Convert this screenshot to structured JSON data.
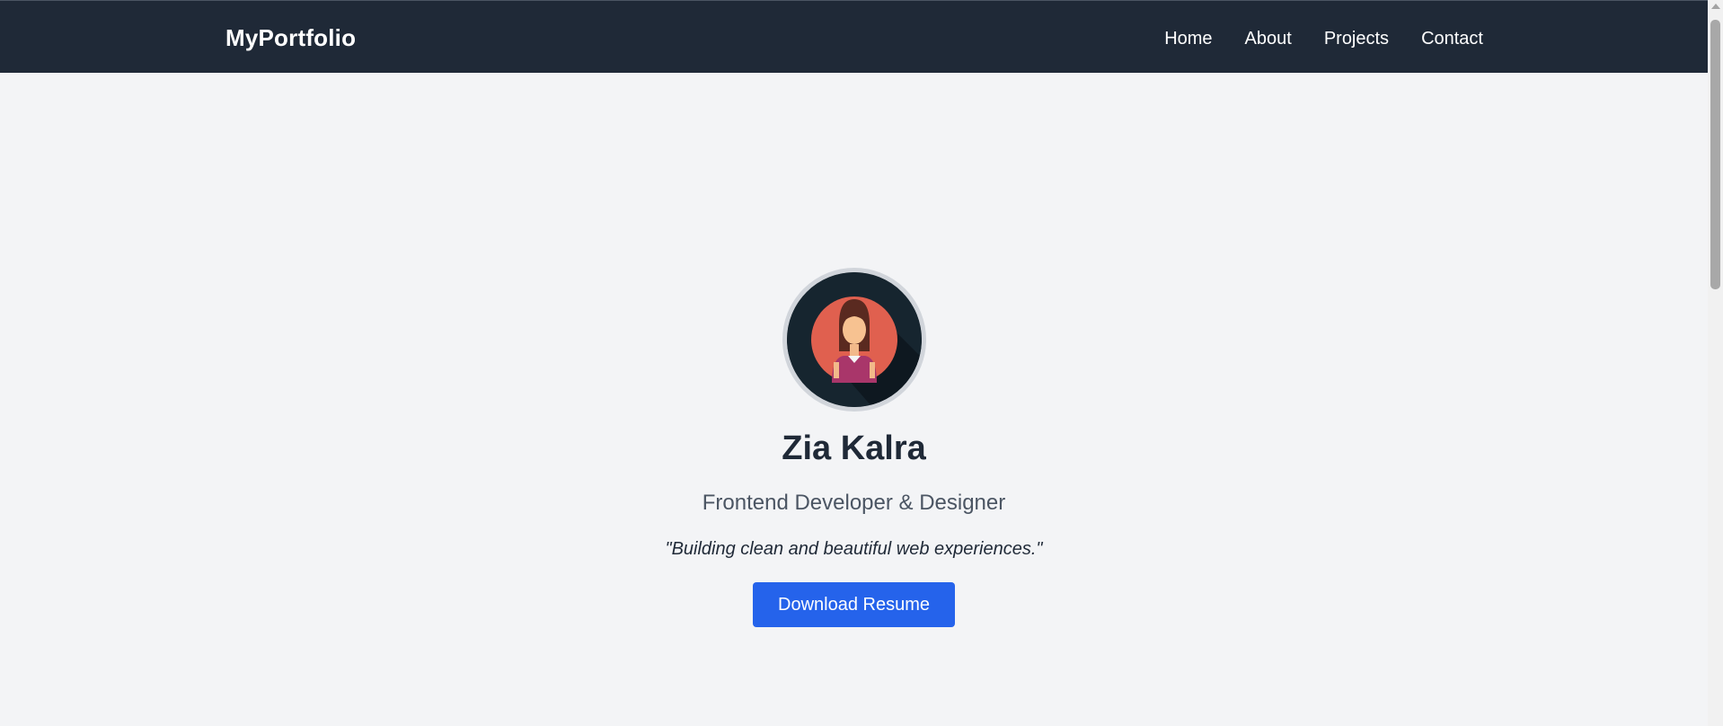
{
  "navbar": {
    "brand": "MyPortfolio",
    "links": [
      "Home",
      "About",
      "Projects",
      "Contact"
    ]
  },
  "hero": {
    "name": "Zia Kalra",
    "role": "Frontend Developer & Designer",
    "tagline": "\"Building clean and beautiful web experiences.\"",
    "button_label": "Download Resume",
    "avatar_icon": "woman-avatar-icon"
  },
  "colors": {
    "navbar_bg": "#1f2937",
    "page_bg": "#f3f4f6",
    "button_bg": "#2563eb",
    "avatar_ring": "#d1d5db"
  }
}
